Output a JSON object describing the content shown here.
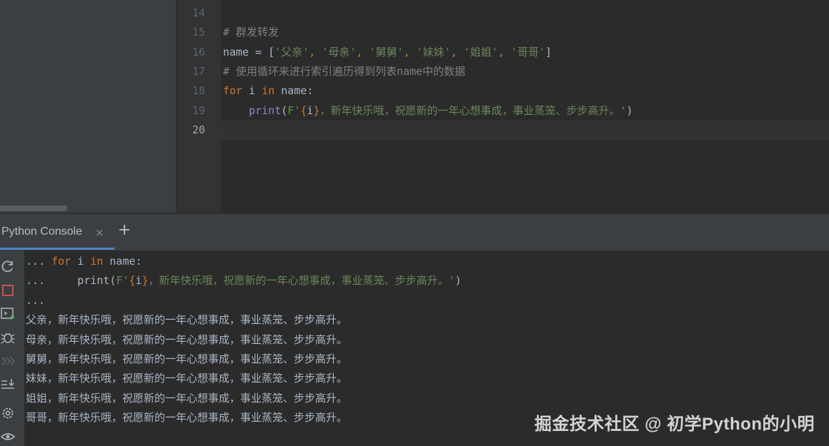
{
  "editor": {
    "lines": [
      {
        "num": "14",
        "code": []
      },
      {
        "num": "15",
        "code": [
          {
            "t": "# 群发转发",
            "c": "comment"
          }
        ]
      },
      {
        "num": "16",
        "code": [
          {
            "t": "name = [",
            "c": "var"
          },
          {
            "t": "'父亲'",
            "c": "str"
          },
          {
            "t": ", ",
            "c": "kw"
          },
          {
            "t": "'母亲'",
            "c": "str"
          },
          {
            "t": ", ",
            "c": "kw"
          },
          {
            "t": "'舅舅'",
            "c": "str"
          },
          {
            "t": ", ",
            "c": "kw"
          },
          {
            "t": "'妹妹'",
            "c": "str"
          },
          {
            "t": ", ",
            "c": "kw"
          },
          {
            "t": "'姐姐'",
            "c": "str"
          },
          {
            "t": ", ",
            "c": "kw"
          },
          {
            "t": "'哥哥'",
            "c": "str"
          },
          {
            "t": "]",
            "c": "var"
          }
        ]
      },
      {
        "num": "17",
        "code": [
          {
            "t": "# 使用循环来进行索引遍历得到列表name中的数据",
            "c": "comment"
          }
        ]
      },
      {
        "num": "18",
        "code": [
          {
            "t": "for",
            "c": "kw"
          },
          {
            "t": " i ",
            "c": "var"
          },
          {
            "t": "in",
            "c": "kw"
          },
          {
            "t": " name:",
            "c": "var"
          }
        ]
      },
      {
        "num": "19",
        "code": [
          {
            "t": "    ",
            "c": "var"
          },
          {
            "t": "print",
            "c": "fn"
          },
          {
            "t": "(",
            "c": "var"
          },
          {
            "t": "F'",
            "c": "str"
          },
          {
            "t": "{",
            "c": "brace"
          },
          {
            "t": "i",
            "c": "var"
          },
          {
            "t": "}",
            "c": "brace"
          },
          {
            "t": "，新年快乐哦，祝愿新的一年心想事成，事业蒸笼、步步高升。'",
            "c": "str"
          },
          {
            "t": ")",
            "c": "var"
          }
        ]
      },
      {
        "num": "20",
        "code": []
      }
    ]
  },
  "tool_window": {
    "tab_label": "Python Console",
    "close_glyph": "×",
    "add_glyph": "+"
  },
  "console": {
    "lines": [
      [
        {
          "t": "... ",
          "c": "var"
        },
        {
          "t": "for",
          "c": "kw"
        },
        {
          "t": " i ",
          "c": "var"
        },
        {
          "t": "in",
          "c": "kw"
        },
        {
          "t": " name:",
          "c": "var"
        }
      ],
      [
        {
          "t": "...     ",
          "c": "var"
        },
        {
          "t": "print(",
          "c": "var"
        },
        {
          "t": "F'",
          "c": "str"
        },
        {
          "t": "{",
          "c": "brace"
        },
        {
          "t": "i",
          "c": "var"
        },
        {
          "t": "}",
          "c": "brace"
        },
        {
          "t": "，新年快乐哦，祝愿新的一年心想事成，事业蒸笼、步步高升。'",
          "c": "str"
        },
        {
          "t": ")",
          "c": "var"
        }
      ],
      [
        {
          "t": "...",
          "c": "var"
        }
      ],
      [
        {
          "t": "父亲，新年快乐哦，祝愿新的一年心想事成，事业蒸笼、步步高升。",
          "c": "var"
        }
      ],
      [
        {
          "t": "母亲，新年快乐哦，祝愿新的一年心想事成，事业蒸笼、步步高升。",
          "c": "var"
        }
      ],
      [
        {
          "t": "舅舅，新年快乐哦，祝愿新的一年心想事成，事业蒸笼、步步高升。",
          "c": "var"
        }
      ],
      [
        {
          "t": "妹妹，新年快乐哦，祝愿新的一年心想事成，事业蒸笼、步步高升。",
          "c": "var"
        }
      ],
      [
        {
          "t": "姐姐，新年快乐哦，祝愿新的一年心想事成，事业蒸笼、步步高升。",
          "c": "var"
        }
      ],
      [
        {
          "t": "哥哥，新年快乐哦，祝愿新的一年心想事成，事业蒸笼、步步高升。",
          "c": "var"
        }
      ]
    ]
  },
  "side_tools": [
    {
      "name": "rerun-icon",
      "color": "#afb1b3"
    },
    {
      "name": "stop-icon",
      "color": "#c75450"
    },
    {
      "name": "new-console-icon",
      "color": "#afb1b3"
    },
    {
      "name": "debug-icon",
      "color": "#afb1b3"
    },
    {
      "name": "command-history-icon",
      "color": "#5e6060"
    },
    {
      "name": "soft-wrap-icon",
      "color": "#afb1b3"
    },
    {
      "name": "settings-icon",
      "color": "#afb1b3"
    },
    {
      "name": "show-variables-icon",
      "color": "#afb1b3"
    }
  ],
  "watermark": "掘金技术社区 @ 初学Python的小明",
  "colors": {
    "background": "#2b2b2b",
    "panel": "#3c3f41",
    "keyword": "#cc7832",
    "string": "#6a8759",
    "comment": "#808080",
    "builtin": "#8888c6",
    "accent": "#4a88c7"
  }
}
